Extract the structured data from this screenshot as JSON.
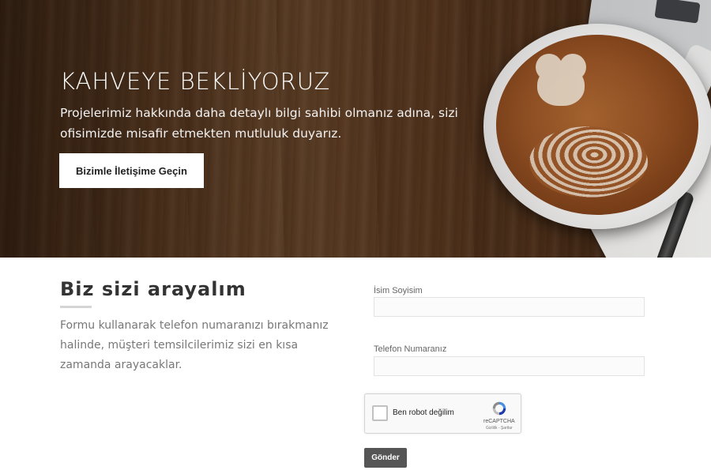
{
  "hero": {
    "title": "KAHVEYE BEKLİYORUZ",
    "text": "Projelerimiz hakkında daha detaylı bilgi sahibi olmanız adına, sizi ofisimizde misafir etmekten mutluluk duyarız.",
    "button_label": "Bizimle İletişime Geçin"
  },
  "callback": {
    "title": "Biz sizi arayalım",
    "text": "Formu kullanarak telefon numaranızı bırakmanız halinde, müşteri temsilcilerimiz sizi en kısa zamanda arayacaklar."
  },
  "form": {
    "name_label": "İsim Soyisim",
    "name_value": "",
    "phone_label": "Telefon Numaranız",
    "phone_value": "",
    "captcha": {
      "label": "Ben robot değilim",
      "brand": "reCAPTCHA",
      "links": "Gizlilik - Şartlar",
      "icon": "recaptcha-icon"
    },
    "submit_label": "Gönder"
  },
  "colors": {
    "submit_bg": "#555555",
    "hero_button_bg": "#ffffff",
    "input_border": "#e3e3e3"
  }
}
